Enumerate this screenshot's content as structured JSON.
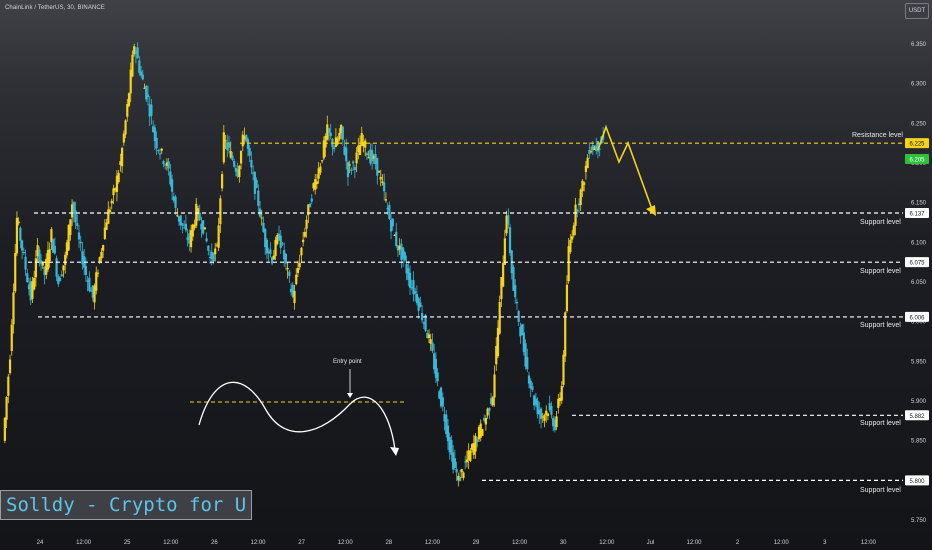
{
  "header": {
    "symbol_line": "ChainLink / TetherUS, 30, BINANCE",
    "currency": "USDT"
  },
  "watermark": "Solldy - Crypto for U",
  "colors": {
    "up": "#f5d31a",
    "down": "#3ab7d6",
    "level": "#ffffff",
    "resistance": "#f5d31a",
    "current_price_badge": "#2ec23a",
    "text": "#d1d4dc"
  },
  "chart_data": {
    "type": "candlestick",
    "y_ticks": [
      "6.350",
      "6.300",
      "6.250",
      "6.200",
      "6.150",
      "6.100",
      "6.050",
      "6.000",
      "5.950",
      "5.900",
      "5.850",
      "5.800",
      "5.750"
    ],
    "x_ticks": [
      "24",
      "12:00",
      "25",
      "12:00",
      "26",
      "12:00",
      "27",
      "12:00",
      "28",
      "12:00",
      "29",
      "12:00",
      "30",
      "12:00",
      "Jul",
      "12:00",
      "2",
      "12:00",
      "3",
      "12:00"
    ],
    "ylim": [
      5.74,
      6.37
    ],
    "price_series_approx": [
      5.85,
      5.96,
      6.13,
      6.08,
      6.03,
      6.09,
      6.06,
      6.11,
      6.05,
      6.08,
      6.15,
      6.1,
      6.06,
      6.03,
      6.08,
      6.13,
      6.16,
      6.2,
      6.27,
      6.35,
      6.31,
      6.28,
      6.23,
      6.21,
      6.19,
      6.14,
      6.12,
      6.1,
      6.14,
      6.12,
      6.08,
      6.09,
      6.23,
      6.21,
      6.19,
      6.24,
      6.19,
      6.15,
      6.1,
      6.08,
      6.11,
      6.07,
      6.03,
      6.08,
      6.13,
      6.17,
      6.2,
      6.24,
      6.22,
      6.24,
      6.19,
      6.2,
      6.23,
      6.21,
      6.2,
      6.17,
      6.13,
      6.1,
      6.08,
      6.05,
      6.03,
      6.0,
      5.97,
      5.92,
      5.88,
      5.83,
      5.8,
      5.82,
      5.84,
      5.86,
      5.88,
      5.91,
      6.02,
      6.14,
      6.04,
      5.99,
      5.94,
      5.9,
      5.88,
      5.89,
      5.87,
      5.92,
      6.09,
      6.14,
      6.17,
      6.22,
      6.22,
      6.23
    ],
    "levels": [
      {
        "label": "Resistance level",
        "price": 6.225,
        "badge": "6.225",
        "style": "yellow-dashed"
      },
      {
        "label": "Support level",
        "price": 6.137,
        "badge": "6.137"
      },
      {
        "label": "Support level",
        "price": 6.075,
        "badge": "6.075"
      },
      {
        "label": "Support level",
        "price": 6.006,
        "badge": "6.006"
      },
      {
        "label": "Support level",
        "price": 5.882,
        "badge": "5.882"
      },
      {
        "label": "Support level",
        "price": 5.8,
        "badge": "5.800"
      }
    ],
    "current_price": "6.205",
    "annotation": {
      "text": "Entry point",
      "price": 5.9
    }
  }
}
